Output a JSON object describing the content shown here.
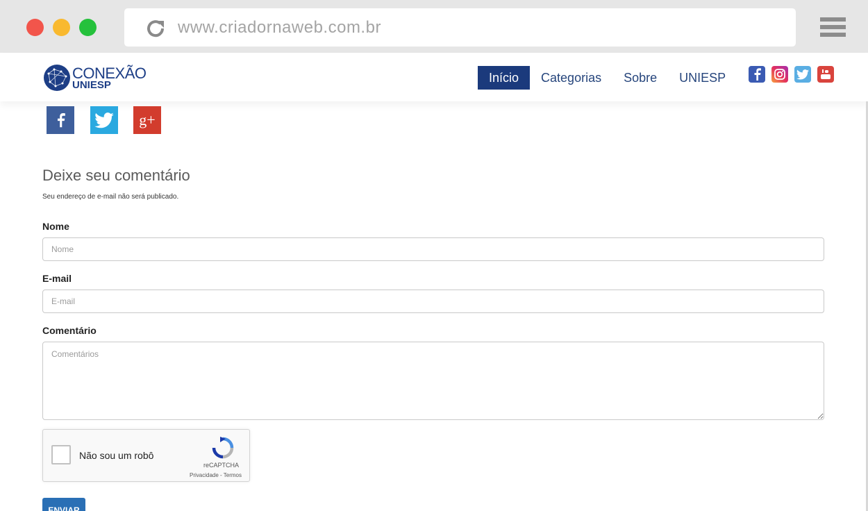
{
  "browser": {
    "url": "www.criadornaweb.com.br"
  },
  "header": {
    "logo_line1": "CONEXÃO",
    "logo_line2": "UNIESP",
    "nav": [
      {
        "label": "Início",
        "active": true
      },
      {
        "label": "Categorias",
        "active": false
      },
      {
        "label": "Sobre",
        "active": false
      },
      {
        "label": "UNIESP",
        "active": false
      }
    ],
    "social_icons": [
      "facebook-icon",
      "instagram-icon",
      "twitter-icon",
      "youtube-icon"
    ]
  },
  "share": {
    "icons": [
      "facebook-share-icon",
      "twitter-share-icon",
      "google-plus-share-icon"
    ],
    "gplus_glyph": "g+"
  },
  "comment_form": {
    "title": "Deixe seu comentário",
    "note": "Seu endereço de e-mail não será publicado.",
    "name_label": "Nome",
    "name_placeholder": "Nome",
    "email_label": "E-mail",
    "email_placeholder": "E-mail",
    "comment_label": "Comentário",
    "comment_placeholder": "Comentários",
    "captcha_label": "Não sou um robô",
    "captcha_brand": "reCAPTCHA",
    "captcha_links": "Privacidade - Termos",
    "submit_label": "ENVIAR"
  },
  "colors": {
    "nav_active": "#1b3a7c",
    "brand": "#1d3e86",
    "submit": "#2a6fb5"
  }
}
